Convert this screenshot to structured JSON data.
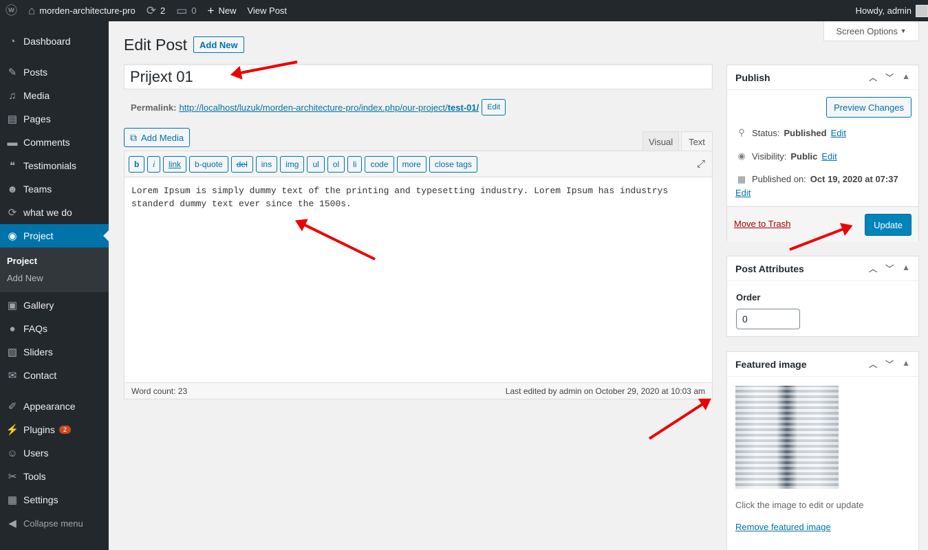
{
  "adminbar": {
    "wp_icon": "wordpress-logo-icon",
    "site_name": "morden-architecture-pro",
    "updates_count": "2",
    "comments_count": "0",
    "new_label": "New",
    "view_post": "View Post",
    "howdy": "Howdy, admin"
  },
  "sidebar": {
    "items": [
      {
        "label": "Dashboard",
        "icon": "dashboard-icon"
      },
      {
        "label": "Posts",
        "icon": "pin-icon"
      },
      {
        "label": "Media",
        "icon": "media-icon"
      },
      {
        "label": "Pages",
        "icon": "pages-icon"
      },
      {
        "label": "Comments",
        "icon": "comment-icon"
      },
      {
        "label": "Testimonials",
        "icon": "testimonial-icon"
      },
      {
        "label": "Teams",
        "icon": "groups-icon"
      },
      {
        "label": "what we do",
        "icon": "update-icon"
      },
      {
        "label": "Project",
        "icon": "visibility-icon"
      },
      {
        "label": "Gallery",
        "icon": "gallery-icon"
      },
      {
        "label": "FAQs",
        "icon": "faq-icon"
      },
      {
        "label": "Sliders",
        "icon": "slides-icon"
      },
      {
        "label": "Contact",
        "icon": "email-icon"
      },
      {
        "label": "Appearance",
        "icon": "brush-icon"
      },
      {
        "label": "Plugins",
        "icon": "plugin-icon"
      },
      {
        "label": "Users",
        "icon": "users-icon"
      },
      {
        "label": "Tools",
        "icon": "tools-icon"
      },
      {
        "label": "Settings",
        "icon": "settings-icon"
      },
      {
        "label": "Collapse menu",
        "icon": "collapse-icon"
      }
    ],
    "submenu": [
      "Project",
      "Add New"
    ],
    "plugins_badge": "2"
  },
  "screen_options": "Screen Options",
  "page": {
    "title": "Edit Post",
    "add_new": "Add New",
    "post_title": "Prijext 01",
    "permalink_label": "Permalink:",
    "permalink_base": "http://localhost/luzuk/morden-architecture-pro/index.php/our-project/",
    "permalink_slug": "test-01/",
    "permalink_edit": "Edit"
  },
  "editor": {
    "add_media": "Add Media",
    "tab_visual": "Visual",
    "tab_text": "Text",
    "quicktags": [
      "b",
      "i",
      "link",
      "b-quote",
      "del",
      "ins",
      "img",
      "ul",
      "ol",
      "li",
      "code",
      "more",
      "close tags"
    ],
    "content": "Lorem Ipsum is simply dummy text of the printing and typesetting industry. Lorem Ipsum has industrys standerd dummy text ever since the 1500s.",
    "word_count": "Word count: 23",
    "last_edited": "Last edited by admin on October 29, 2020 at 10:03 am"
  },
  "publish": {
    "title": "Publish",
    "preview": "Preview Changes",
    "status_label": "Status:",
    "status_value": "Published",
    "visibility_label": "Visibility:",
    "visibility_value": "Public",
    "published_label": "Published on:",
    "published_value": "Oct 19, 2020 at 07:37",
    "edit": "Edit",
    "trash": "Move to Trash",
    "update": "Update"
  },
  "attributes": {
    "title": "Post Attributes",
    "order_label": "Order",
    "order_value": "0"
  },
  "featured": {
    "title": "Featured image",
    "hint": "Click the image to edit or update",
    "remove": "Remove featured image"
  }
}
